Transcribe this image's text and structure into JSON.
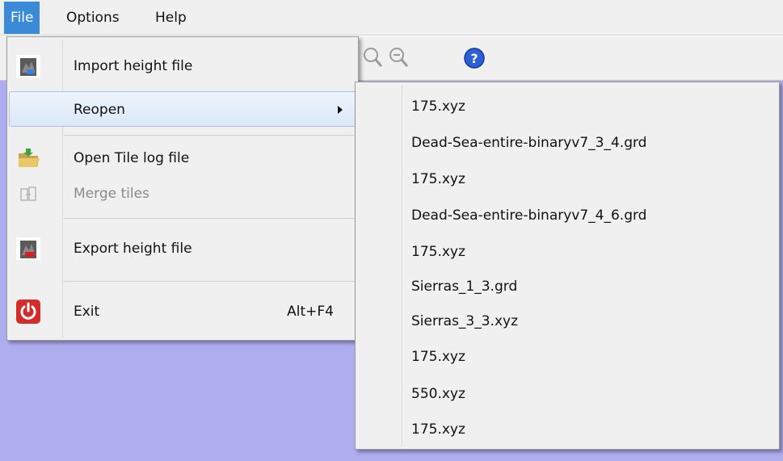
{
  "menubar": {
    "items": [
      {
        "label": "File",
        "active": true
      },
      {
        "label": "Options",
        "active": false
      },
      {
        "label": "Help",
        "active": false
      }
    ]
  },
  "toolbar": {
    "icons": [
      "zoom-in-icon",
      "zoom-out-icon",
      "help-icon"
    ]
  },
  "colors": {
    "menu_active": "#3b8ad8",
    "workspace": "#adadf0",
    "menu_bg": "#f0f0f0",
    "highlight_border": "#a7c4e8"
  },
  "file_menu": {
    "items": [
      {
        "label": "Import height file",
        "icon": "import-height-icon",
        "enabled": true
      },
      {
        "label": "Reopen",
        "has_submenu": true,
        "highlighted": true,
        "enabled": true
      },
      {
        "label": "Open Tile log file",
        "icon": "folder-open-icon",
        "enabled": true
      },
      {
        "label": "Merge tiles",
        "icon": "merge-tiles-icon",
        "enabled": false
      },
      {
        "label": "Export height file",
        "icon": "export-height-icon",
        "enabled": true
      },
      {
        "label": "Exit",
        "shortcut": "Alt+F4",
        "icon": "power-icon",
        "enabled": true
      }
    ]
  },
  "reopen_submenu": {
    "items": [
      "175.xyz",
      "Dead-Sea-entire-binaryv7_3_4.grd",
      "175.xyz",
      "Dead-Sea-entire-binaryv7_4_6.grd",
      "175.xyz",
      "Sierras_1_3.grd",
      "Sierras_3_3.xyz",
      "175.xyz",
      "550.xyz",
      "175.xyz"
    ]
  }
}
